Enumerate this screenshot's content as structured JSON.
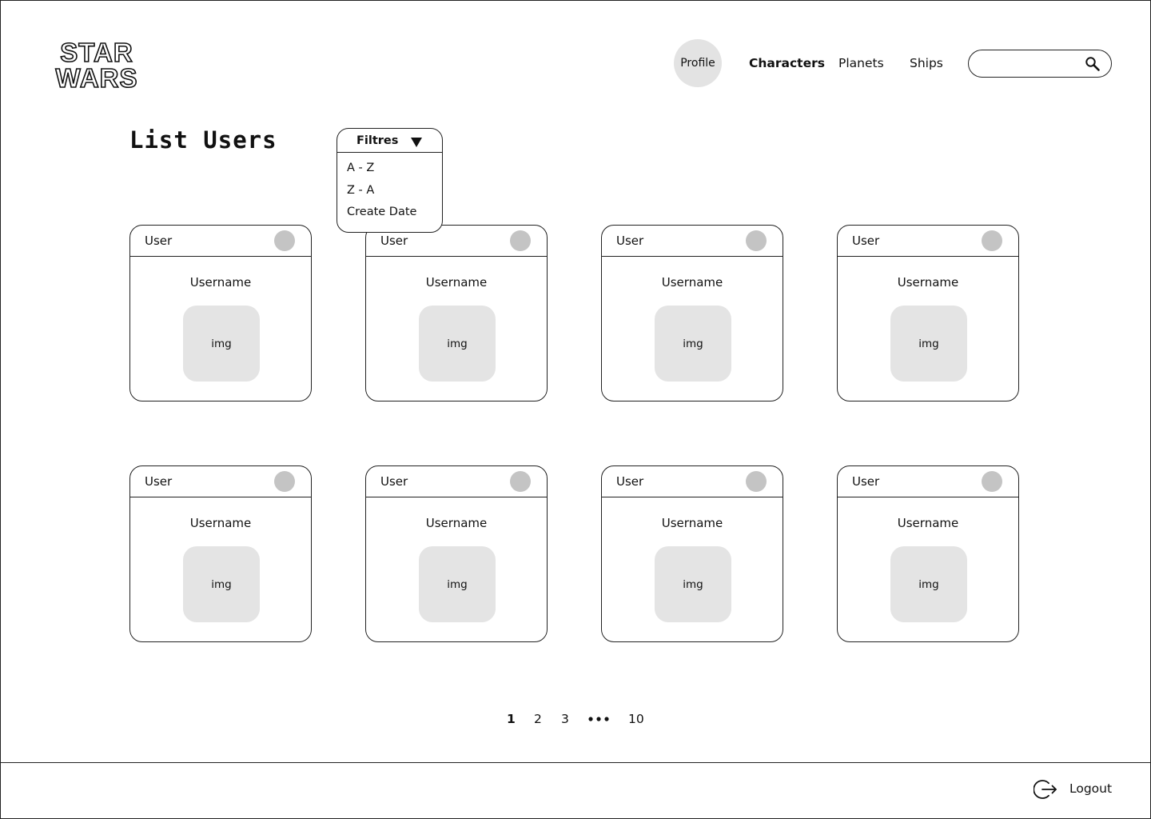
{
  "header": {
    "logo_text": [
      "STAR",
      "WARS"
    ],
    "profile_label": "Profile",
    "nav": [
      {
        "label": "Characters",
        "active": true
      },
      {
        "label": "Planets",
        "active": false
      },
      {
        "label": "Ships",
        "active": false
      }
    ],
    "search": {
      "value": "",
      "placeholder": ""
    }
  },
  "main": {
    "title": "List Users",
    "filter": {
      "label": "Filtres",
      "options": [
        "A - Z",
        "Z - A",
        "Create Date"
      ]
    },
    "cards": [
      {
        "label": "User",
        "username": "Username",
        "image": "img"
      },
      {
        "label": "User",
        "username": "Username",
        "image": "img"
      },
      {
        "label": "User",
        "username": "Username",
        "image": "img"
      },
      {
        "label": "User",
        "username": "Username",
        "image": "img"
      },
      {
        "label": "User",
        "username": "Username",
        "image": "img"
      },
      {
        "label": "User",
        "username": "Username",
        "image": "img"
      },
      {
        "label": "User",
        "username": "Username",
        "image": "img"
      },
      {
        "label": "User",
        "username": "Username",
        "image": "img"
      }
    ],
    "pagination": {
      "pages": [
        "1",
        "2",
        "3",
        "10"
      ],
      "current": "1"
    }
  },
  "footer": {
    "logout_label": "Logout"
  },
  "icons": {
    "search": "search-icon",
    "logout": "logout-icon",
    "dropdown": "caret-down-icon"
  },
  "colors": {
    "border": "#222222",
    "placeholder_fill": "#e4e4e4",
    "dot_fill": "#c4c4c4",
    "profile_fill": "#e3e3e3"
  }
}
